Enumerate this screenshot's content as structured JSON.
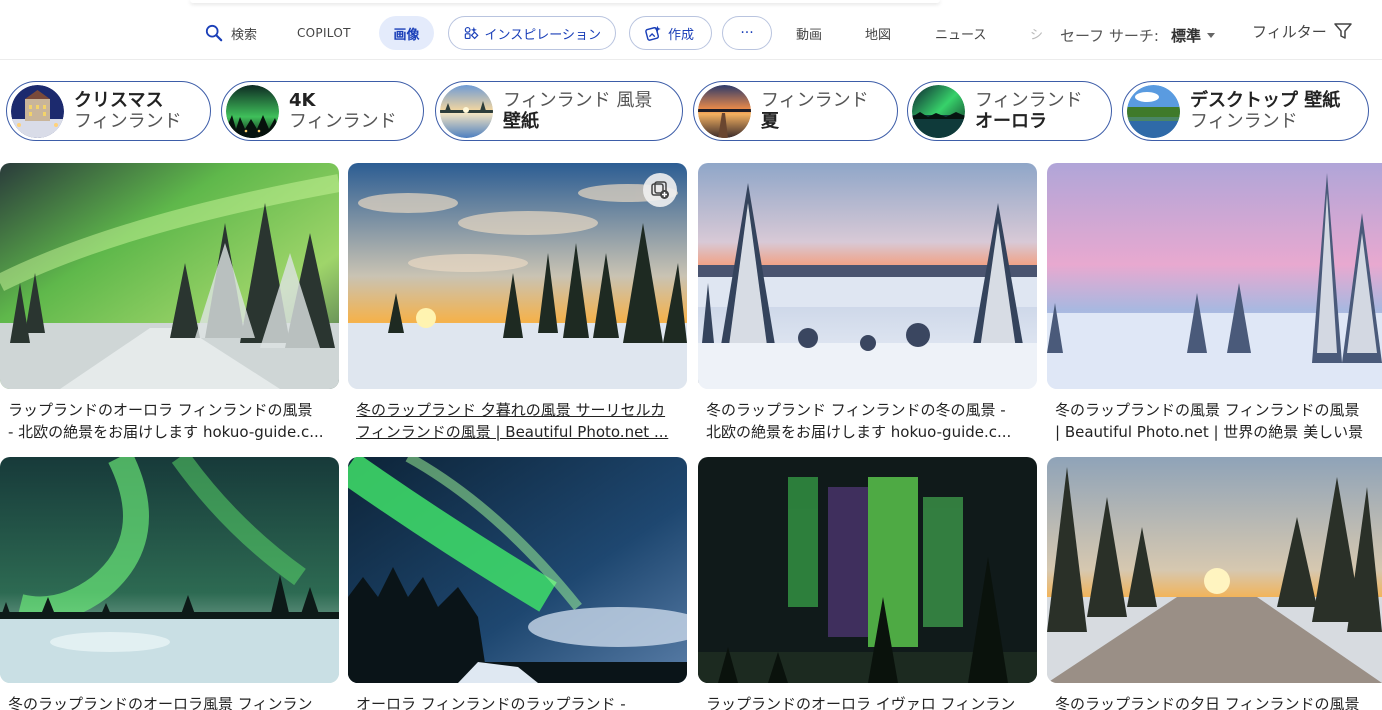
{
  "nav": {
    "search": "検索",
    "copilot": "COPILOT",
    "images": "画像",
    "inspiration": "インスピレーション",
    "create": "作成",
    "more": "···",
    "videos": "動画",
    "maps": "地図",
    "news": "ニュース",
    "truncated": "シ",
    "safesearch_label": "セーフ サーチ:",
    "safesearch_value": "標準",
    "filter": "フィルター"
  },
  "chips": [
    {
      "line1": "クリスマス",
      "line2": "フィンランド",
      "bold_line": 1
    },
    {
      "line1": "4K",
      "line2": "フィンランド",
      "bold_line": 1
    },
    {
      "line1": "フィンランド 風景",
      "line2": "壁紙",
      "bold_line": 2
    },
    {
      "line1": "フィンランド",
      "line2": "夏",
      "bold_line": 2
    },
    {
      "line1": "フィンランド",
      "line2": "オーロラ",
      "bold_line": 2
    },
    {
      "line1": "デスクトップ 壁紙",
      "line2": "フィンランド",
      "bold_line": 1
    }
  ],
  "results": [
    {
      "caption_line1": "ラップランドのオーロラ フィンランドの風景",
      "caption_line2": "- 北欧の絶景をお届けします hokuo-guide.c...",
      "scene": "aurora-snowy-road"
    },
    {
      "caption_line1": "冬のラップランド 夕暮れの風景 サーリセルカ",
      "caption_line2": "フィンランドの風景 | Beautiful Photo.net ...",
      "scene": "sunset-forest",
      "hovered": true
    },
    {
      "caption_line1": "冬のラップランド フィンランドの冬の風景 -",
      "caption_line2": "北欧の絶景をお届けします hokuo-guide.c...",
      "scene": "snowy-lake-dusk"
    },
    {
      "caption_line1": "冬のラップランドの風景 フィンランドの風景",
      "caption_line2": "| Beautiful Photo.net | 世界の絶景 美しい景色",
      "scene": "pink-sky-snow"
    },
    {
      "caption_line1": "冬のラップランドのオーロラ風景 フィンラン",
      "caption_line2": "",
      "scene": "aurora-snowfield"
    },
    {
      "caption_line1": "オーロラ フィンランドのラップランド -",
      "caption_line2": "",
      "scene": "aurora-blue-sky"
    },
    {
      "caption_line1": "ラップランドのオーロラ イヴァロ フィンラン",
      "caption_line2": "",
      "scene": "aurora-curtain"
    },
    {
      "caption_line1": "冬のラップランドの夕日 フィンランドの風景",
      "caption_line2": "",
      "scene": "sunset-road"
    }
  ],
  "colors": {
    "accent": "#1a3fb8",
    "chip_border": "#3d5da8",
    "active_tab_bg": "#e4ebfb"
  }
}
